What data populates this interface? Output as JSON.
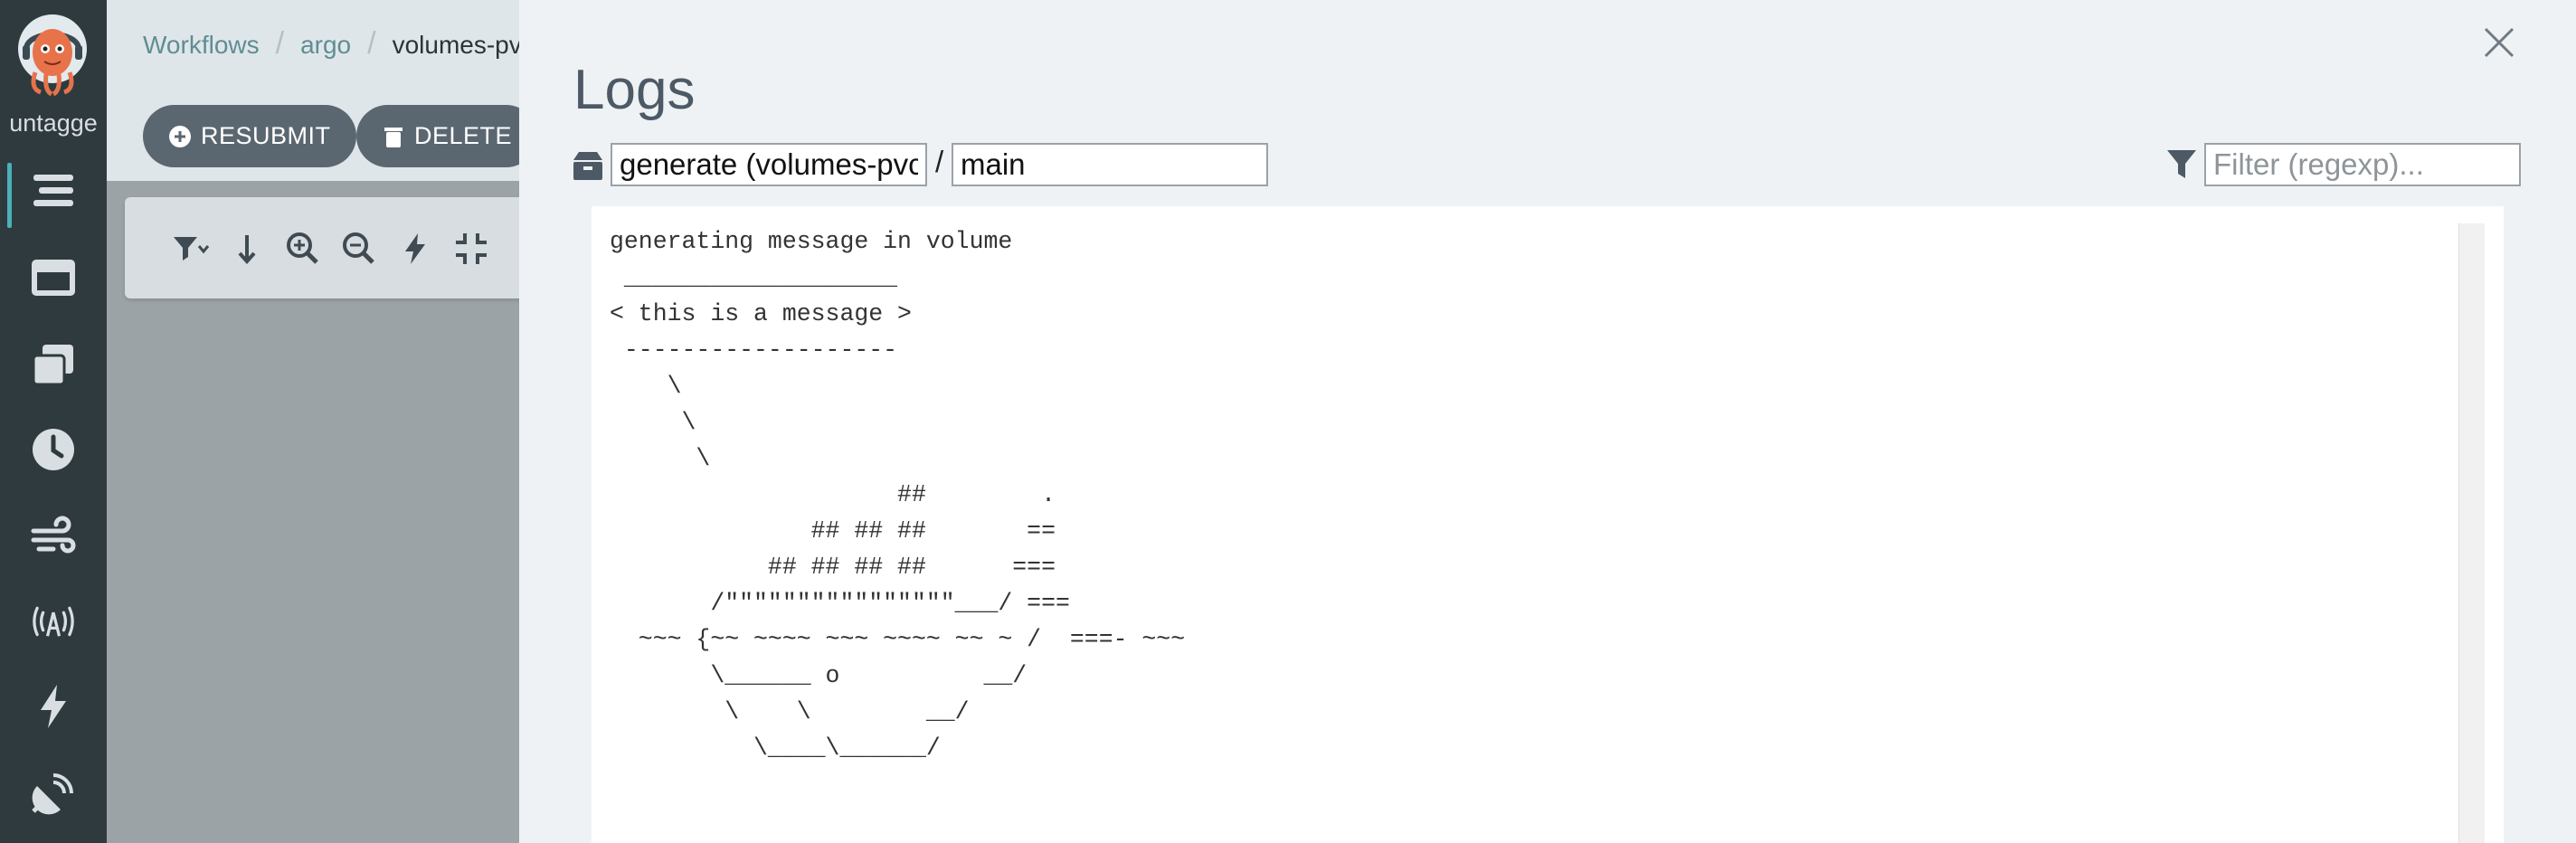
{
  "nav": {
    "user_label": "untagge",
    "items": [
      {
        "icon": "stream-icon",
        "active": true
      },
      {
        "icon": "window-icon"
      },
      {
        "icon": "clone-icon"
      },
      {
        "icon": "clock-icon"
      },
      {
        "icon": "wind-icon"
      },
      {
        "icon": "broadcast-icon"
      },
      {
        "icon": "bolt-icon"
      },
      {
        "icon": "satellite-dish-icon"
      }
    ]
  },
  "breadcrumb": {
    "items": [
      "Workflows",
      "argo",
      "volumes-pvc-"
    ]
  },
  "actions": {
    "resubmit": "RESUBMIT",
    "delete": "DELETE"
  },
  "toolbar": {
    "icons": [
      "filter-dropdown-icon",
      "arrow-down-icon",
      "zoom-in-icon",
      "zoom-out-icon",
      "bolt-icon",
      "compress-icon"
    ]
  },
  "logs_panel": {
    "title": "Logs",
    "pod_value": "generate (volumes-pvc-",
    "separator": "/",
    "container_value": "main",
    "filter_placeholder": "Filter (regexp)...",
    "log_text": "generating message in volume\n ___________________ \n< this is a message >\n ------------------- \n    \\\n     \\\n      \\     \n                    ##        .            \n              ## ## ##       ==            \n           ## ## ## ##      ===            \n       /\"\"\"\"\"\"\"\"\"\"\"\"\"\"\"\"___/ ===        \n  ~~~ {~~ ~~~~ ~~~ ~~~~ ~~ ~ /  ===- ~~~   \n       \\______ o          __/            \n        \\    \\        __/             \n          \\____\\______/   "
  },
  "colors": {
    "nav_bg": "#2f3a3f",
    "accent": "#4bb0b8",
    "button_bg": "#5b6770",
    "panel_bg": "#eef2f5"
  }
}
